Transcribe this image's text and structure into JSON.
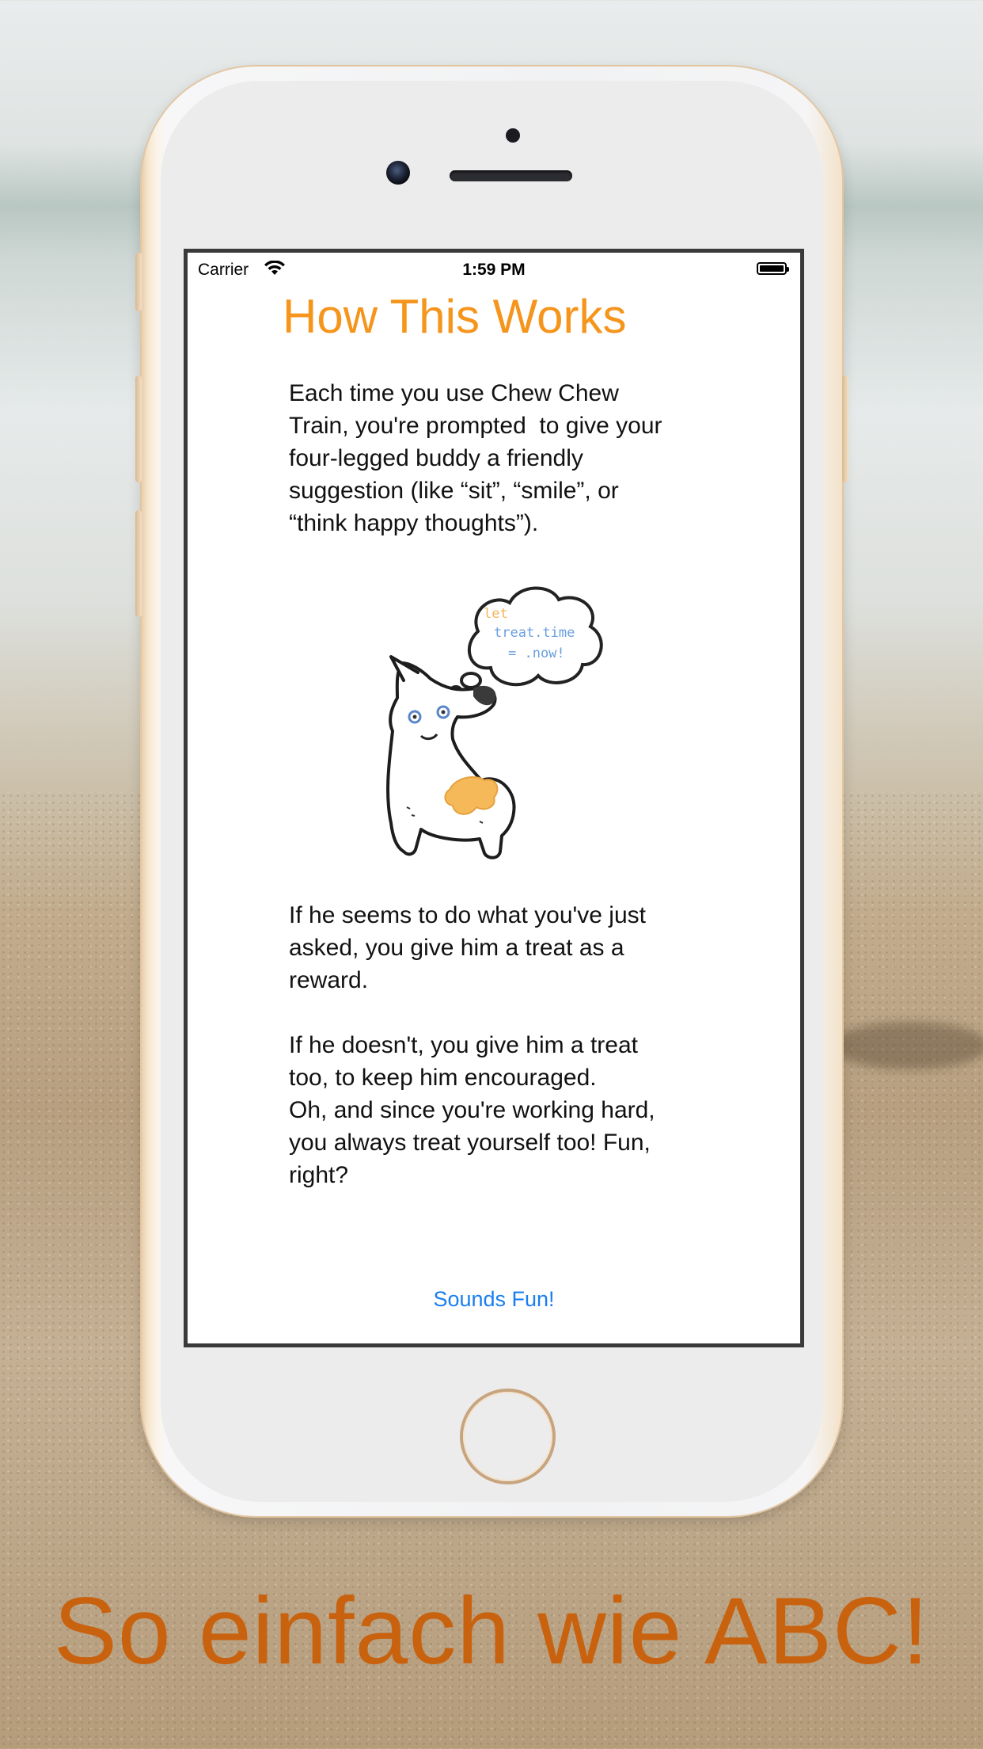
{
  "status_bar": {
    "carrier": "Carrier",
    "time": "1:59 PM"
  },
  "page": {
    "title": "How This Works",
    "intro": "Each time you use Chew Chew\nTrain, you're prompted  to give your\nfour-legged buddy a friendly\nsuggestion (like “sit”, “smile”, or\n“think happy thoughts”).",
    "paragraph_2": "If he seems to do what you've just\nasked, you give him a treat as a\nreward.",
    "paragraph_3": "If he doesn't, you give him a treat\ntoo, to keep him encouraged.",
    "paragraph_4": "Oh, and since you're working hard,\nyou always treat yourself too! Fun,\nright?",
    "action_button": "Sounds Fun!"
  },
  "illustration": {
    "bubble_line_1": "let",
    "bubble_line_2": "treat.time",
    "bubble_line_3": "= .now!"
  },
  "tagline": "So einfach wie ABC!",
  "colors": {
    "title_orange": "#f5951c",
    "button_blue": "#1a7ff0",
    "tagline_orange": "#c9620e",
    "code_orange": "#f3b45c",
    "code_blue": "#6a9fe0"
  }
}
